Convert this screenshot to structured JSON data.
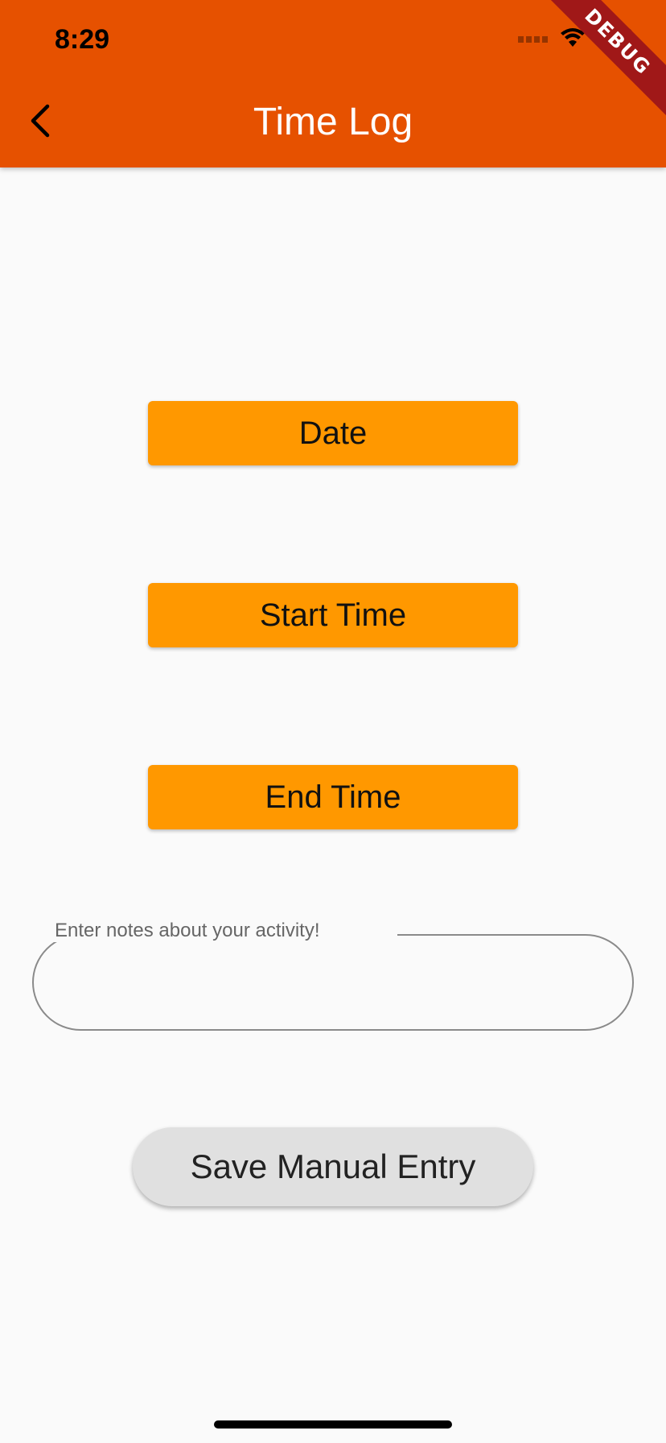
{
  "status_bar": {
    "time": "8:29",
    "icons": [
      "signal-icon",
      "wifi-icon",
      "battery-icon"
    ]
  },
  "debug_banner": "DEBUG",
  "app_bar": {
    "title": "Time Log",
    "back_icon": "chevron-left-icon",
    "background_color": "#e65100"
  },
  "buttons": {
    "date_label": "Date",
    "start_time_label": "Start Time",
    "end_time_label": "End Time",
    "color": "#ff9800"
  },
  "notes": {
    "label": "Enter notes about your activity!",
    "value": ""
  },
  "save": {
    "label": "Save Manual Entry"
  }
}
